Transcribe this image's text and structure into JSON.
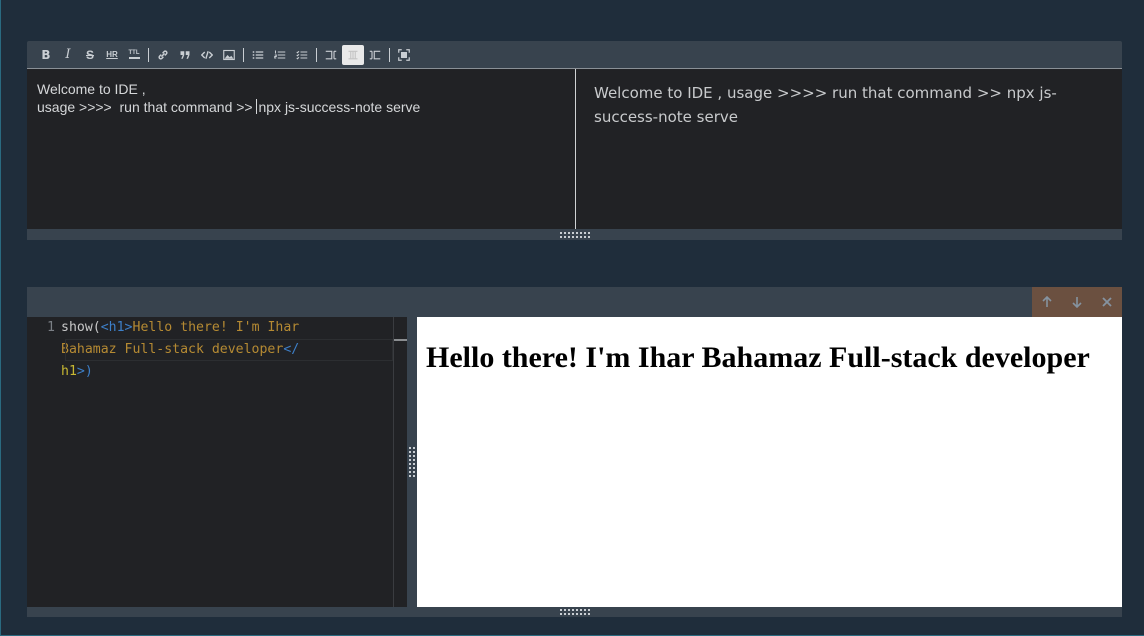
{
  "markdown_cell": {
    "toolbar": [
      {
        "name": "bold",
        "glyph": "B"
      },
      {
        "name": "italic",
        "glyph": "I"
      },
      {
        "name": "strikethrough",
        "glyph": "S"
      },
      {
        "name": "horizontal-rule",
        "glyph": "HR"
      },
      {
        "name": "heading",
        "glyph": "TTL"
      },
      {
        "name": "link"
      },
      {
        "name": "quote"
      },
      {
        "name": "code"
      },
      {
        "name": "image"
      },
      {
        "name": "unordered-list"
      },
      {
        "name": "ordered-list"
      },
      {
        "name": "checklist"
      },
      {
        "name": "editor-only"
      },
      {
        "name": "side-by-side",
        "active": true
      },
      {
        "name": "preview-only"
      },
      {
        "name": "fullscreen"
      }
    ],
    "editor_lines": [
      "Welcome to IDE ,",
      "usage >>>>  run that command >> ",
      "npx js-success-note serve"
    ],
    "preview_text": "Welcome to IDE , usage >>>> run that command >> npx js-success-note serve"
  },
  "code_cell": {
    "actions": [
      {
        "name": "move-up",
        "glyph": "↑"
      },
      {
        "name": "move-down",
        "glyph": "↓"
      },
      {
        "name": "delete",
        "glyph": "×"
      }
    ],
    "line_number": "1",
    "code_tokens": {
      "fn": "show(",
      "tag_open_lt": "<",
      "tag_open_name": "h1",
      "tag_open_gt": ">",
      "content_line1": "Hello there! I'm Ihar",
      "content_line2": "Bahamaz Full-stack developer",
      "tag_close_lt": "</",
      "tag_close_name": "h1",
      "tag_close_gt": ">",
      "fn_close": ")"
    },
    "output_heading": "Hello there! I'm Ihar Bahamaz Full-stack developer"
  },
  "colors": {
    "page_bg": "#1f2d3b",
    "toolbar_bg": "#38434e",
    "editor_bg": "#212225",
    "actions_bg": "#6b5040",
    "tag_blue": "#3d7fc8",
    "string_orange": "#b58a33",
    "name_yellow": "#c8b832"
  }
}
